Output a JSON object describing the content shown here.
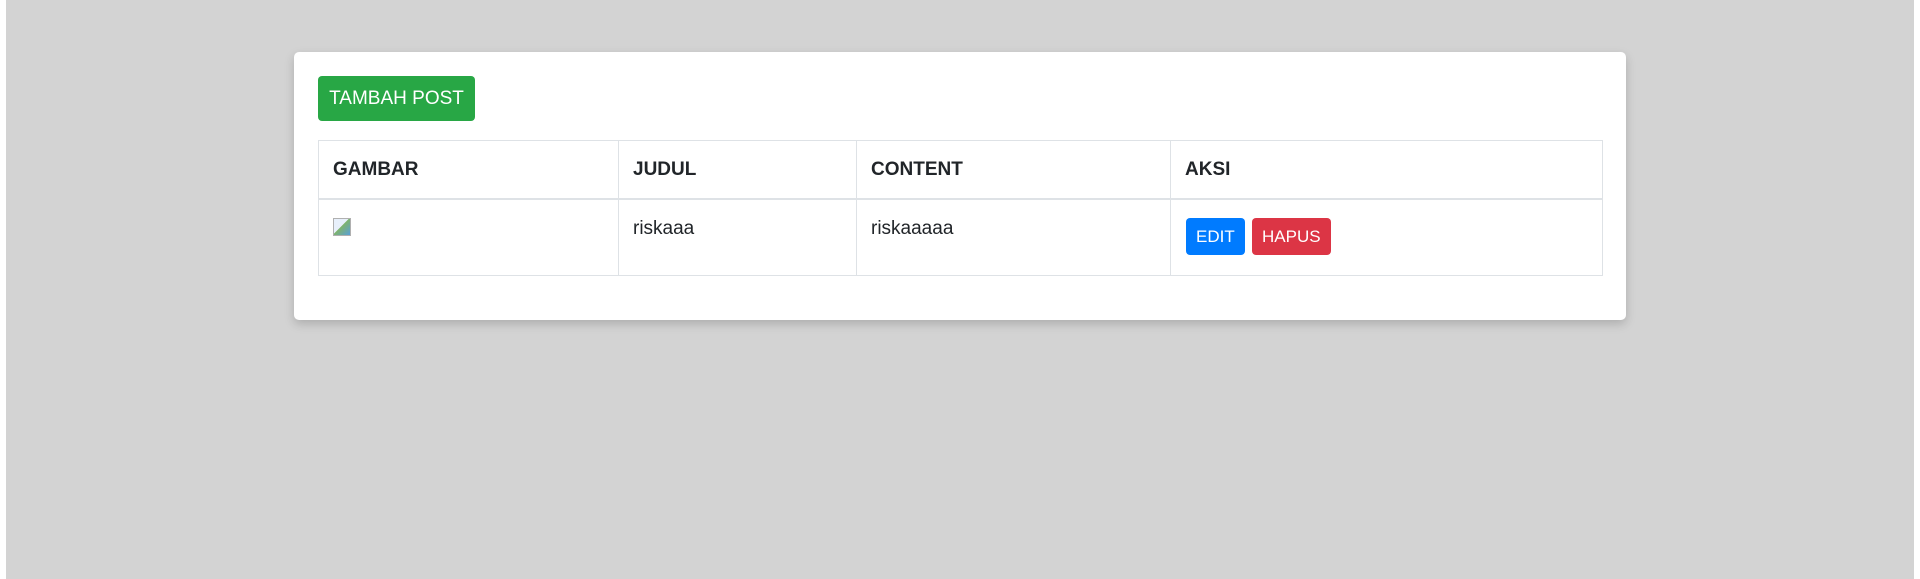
{
  "toolbar": {
    "add_label": "TAMBAH POST"
  },
  "table": {
    "headers": [
      "GAMBAR",
      "JUDUL",
      "CONTENT",
      "AKSI"
    ],
    "rows": [
      {
        "judul": "riskaaa",
        "content": "riskaaaaa",
        "edit_label": "EDIT",
        "delete_label": "HAPUS"
      }
    ]
  },
  "colors": {
    "page_bg": "#d3d3d3",
    "add_button": "#28a745",
    "edit_button": "#007bff",
    "delete_button": "#dc3545"
  },
  "icons": {
    "row_image": "broken-image-icon"
  }
}
